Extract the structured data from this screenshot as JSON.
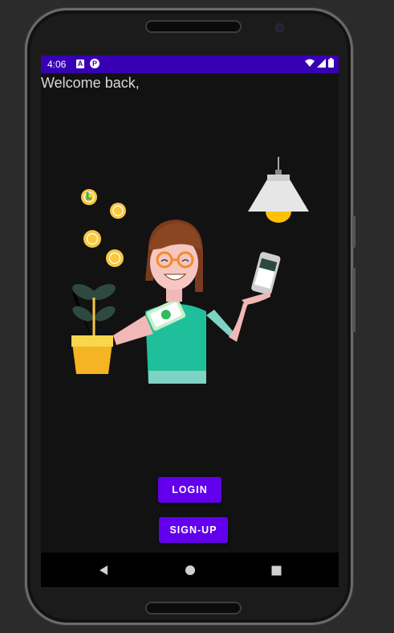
{
  "status_bar": {
    "time": "4:06",
    "icon_a_glyph": "A",
    "icon_p_glyph": "P",
    "icons": [
      "wifi-icon",
      "signal-icon",
      "battery-icon"
    ]
  },
  "welcome_text": "Welcome back,",
  "buttons": {
    "login_label": "LOGIN",
    "signup_label": "SIGN-UP"
  },
  "nav_bar": {
    "icons": [
      "back-icon",
      "home-icon",
      "recents-icon"
    ]
  },
  "colors": {
    "primary_dark": "#3700b3",
    "primary": "#6200ee",
    "background": "#121212"
  }
}
